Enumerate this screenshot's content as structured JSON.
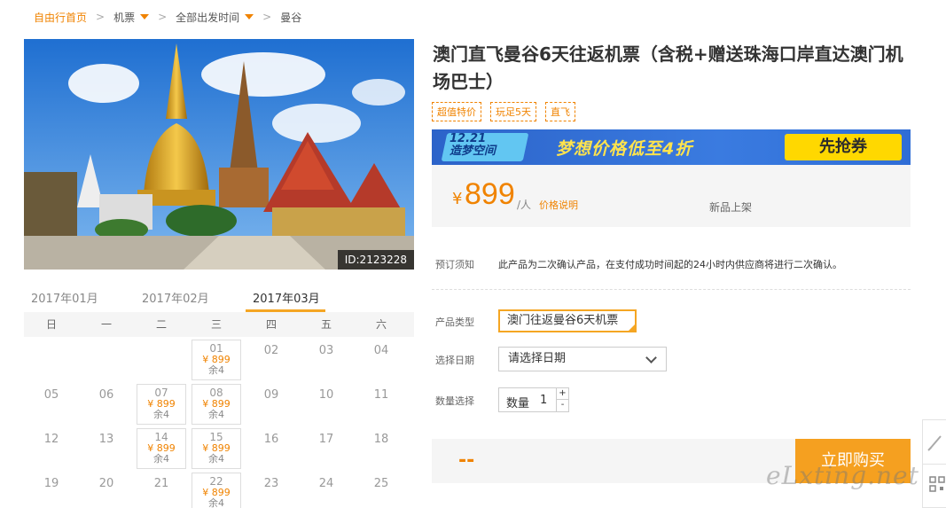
{
  "breadcrumb": {
    "items": [
      {
        "label": "自由行首页",
        "dropdown": false
      },
      {
        "label": "机票",
        "dropdown": true
      },
      {
        "label": "全部出发时间",
        "dropdown": true
      },
      {
        "label": "曼谷",
        "dropdown": false
      }
    ],
    "separator": ">"
  },
  "hero": {
    "image_id": "ID:2123228"
  },
  "calendar": {
    "months": [
      "2017年01月",
      "2017年02月",
      "2017年03月"
    ],
    "active_month": "2017年03月",
    "weekdays": [
      "日",
      "一",
      "二",
      "三",
      "四",
      "五",
      "六"
    ],
    "rows": [
      [
        {
          "day": ""
        },
        {
          "day": ""
        },
        {
          "day": ""
        },
        {
          "day": "01",
          "price": "¥ 899",
          "stock": "余4"
        },
        {
          "day": "02"
        },
        {
          "day": "03"
        },
        {
          "day": "04"
        }
      ],
      [
        {
          "day": "05"
        },
        {
          "day": "06"
        },
        {
          "day": "07",
          "price": "¥ 899",
          "stock": "余4"
        },
        {
          "day": "08",
          "price": "¥ 899",
          "stock": "余4"
        },
        {
          "day": "09"
        },
        {
          "day": "10"
        },
        {
          "day": "11"
        }
      ],
      [
        {
          "day": "12"
        },
        {
          "day": "13"
        },
        {
          "day": "14",
          "price": "¥ 899",
          "stock": "余4"
        },
        {
          "day": "15",
          "price": "¥ 899",
          "stock": "余4"
        },
        {
          "day": "16"
        },
        {
          "day": "17"
        },
        {
          "day": "18"
        }
      ],
      [
        {
          "day": "19"
        },
        {
          "day": "20"
        },
        {
          "day": "21"
        },
        {
          "day": "22",
          "price": "¥ 899",
          "stock": "余4"
        },
        {
          "day": "23"
        },
        {
          "day": "24"
        },
        {
          "day": "25"
        }
      ]
    ]
  },
  "product": {
    "title": "澳门直飞曼谷6天往返机票（含税+赠送珠海口岸直达澳门机场巴士）",
    "tags": [
      "超值特价",
      "玩足5天",
      "直飞"
    ]
  },
  "banner": {
    "left_line1": "12.21",
    "left_line2": "造梦空间",
    "middle": "梦想价格低至4折",
    "button": "先抢券"
  },
  "price": {
    "currency": "¥",
    "value": "899",
    "unit": "/人",
    "explain": "价格说明",
    "status": "新品上架"
  },
  "booking_notice": {
    "label": "预订须知",
    "text": "此产品为二次确认产品，在支付成功时间起的24小时内供应商将进行二次确认。"
  },
  "form": {
    "product_type_label": "产品类型",
    "product_type_value": "澳门往返曼谷6天机票",
    "date_label": "选择日期",
    "date_placeholder": "请选择日期",
    "quantity_label": "数量选择",
    "quantity_field_label": "数量",
    "quantity_value": "1",
    "plus": "+",
    "minus": "-"
  },
  "buy": {
    "total": "--",
    "button": "立即购买"
  },
  "colors": {
    "accent": "#f08300",
    "button_orange": "#f5a020",
    "banner_blue": "#2f6dd6",
    "banner_yellow": "#ffd800"
  },
  "watermark": "eLxting.net",
  "side_tools": [
    "edit-icon",
    "qr-code-icon"
  ]
}
